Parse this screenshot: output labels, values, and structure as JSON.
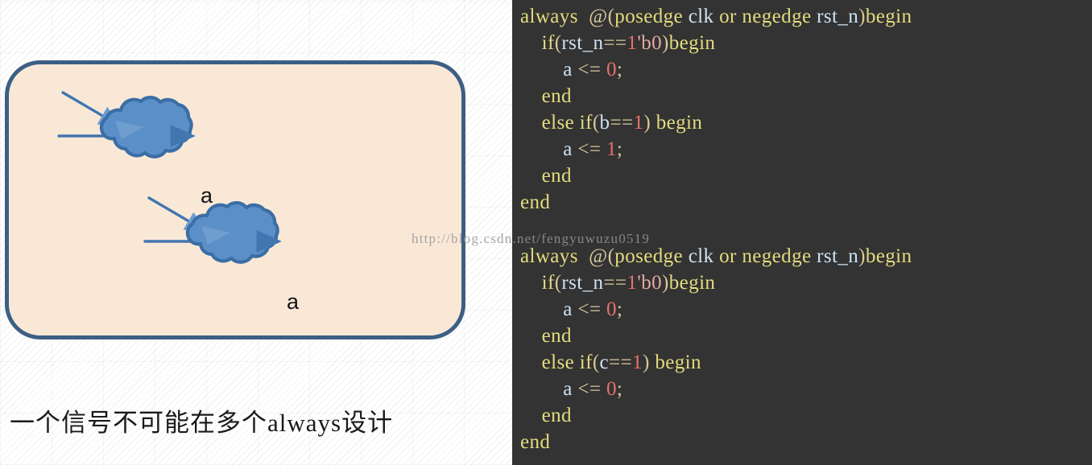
{
  "diagram": {
    "caption": "一个信号不可能在多个always设计",
    "panel_fill": "#fae8d7",
    "panel_border": "#3c5f84",
    "cloud_fill": "#5b8fc7",
    "cloud_stroke": "#3a6ea5",
    "arrow_color": "#4176b0",
    "blocks": [
      {
        "output_label": "a"
      },
      {
        "output_label": "a"
      }
    ]
  },
  "watermark": {
    "text": "http://blog.csdn.net/fengyuwuzu0519"
  },
  "code": {
    "background": "#333333",
    "keyword_color": "#e4dc7e",
    "identifier_color": "#cfe3f2",
    "operator_color": "#d8c89a",
    "number_color": "#e8716a",
    "blocks": [
      {
        "lines": [
          [
            {
              "t": "always",
              "c": "kw"
            },
            {
              "t": "  ",
              "c": "op"
            },
            {
              "t": "@(",
              "c": "op"
            },
            {
              "t": "posedge",
              "c": "kw"
            },
            {
              "t": " ",
              "c": "op"
            },
            {
              "t": "clk",
              "c": "id"
            },
            {
              "t": " ",
              "c": "op"
            },
            {
              "t": "or",
              "c": "kw"
            },
            {
              "t": " ",
              "c": "op"
            },
            {
              "t": "negedge",
              "c": "kw"
            },
            {
              "t": " ",
              "c": "op"
            },
            {
              "t": "rst_n",
              "c": "id"
            },
            {
              "t": ")",
              "c": "op"
            },
            {
              "t": "begin",
              "c": "kw"
            }
          ],
          [
            {
              "t": "    ",
              "c": "op"
            },
            {
              "t": "if",
              "c": "kw"
            },
            {
              "t": "(",
              "c": "op"
            },
            {
              "t": "rst_n",
              "c": "id"
            },
            {
              "t": "==",
              "c": "op"
            },
            {
              "t": "1",
              "c": "num"
            },
            {
              "t": "'b0",
              "c": "numb"
            },
            {
              "t": ")",
              "c": "op"
            },
            {
              "t": "begin",
              "c": "kw"
            }
          ],
          [
            {
              "t": "        ",
              "c": "op"
            },
            {
              "t": "a",
              "c": "id"
            },
            {
              "t": " <= ",
              "c": "op"
            },
            {
              "t": "0",
              "c": "num"
            },
            {
              "t": ";",
              "c": "op"
            }
          ],
          [
            {
              "t": "    ",
              "c": "op"
            },
            {
              "t": "end",
              "c": "kw"
            }
          ],
          [
            {
              "t": "    ",
              "c": "op"
            },
            {
              "t": "else",
              "c": "kw"
            },
            {
              "t": " ",
              "c": "op"
            },
            {
              "t": "if",
              "c": "kw"
            },
            {
              "t": "(",
              "c": "op"
            },
            {
              "t": "b",
              "c": "id"
            },
            {
              "t": "==",
              "c": "op"
            },
            {
              "t": "1",
              "c": "num"
            },
            {
              "t": ") ",
              "c": "op"
            },
            {
              "t": "begin",
              "c": "kw"
            }
          ],
          [
            {
              "t": "        ",
              "c": "op"
            },
            {
              "t": "a",
              "c": "id"
            },
            {
              "t": " <= ",
              "c": "op"
            },
            {
              "t": "1",
              "c": "num"
            },
            {
              "t": ";",
              "c": "op"
            }
          ],
          [
            {
              "t": "    ",
              "c": "op"
            },
            {
              "t": "end",
              "c": "kw"
            }
          ],
          [
            {
              "t": "end",
              "c": "kw"
            }
          ]
        ]
      },
      {
        "lines": [
          [
            {
              "t": "always",
              "c": "kw"
            },
            {
              "t": "  ",
              "c": "op"
            },
            {
              "t": "@(",
              "c": "op"
            },
            {
              "t": "posedge",
              "c": "kw"
            },
            {
              "t": " ",
              "c": "op"
            },
            {
              "t": "clk",
              "c": "id"
            },
            {
              "t": " ",
              "c": "op"
            },
            {
              "t": "or",
              "c": "kw"
            },
            {
              "t": " ",
              "c": "op"
            },
            {
              "t": "negedge",
              "c": "kw"
            },
            {
              "t": " ",
              "c": "op"
            },
            {
              "t": "rst_n",
              "c": "id"
            },
            {
              "t": ")",
              "c": "op"
            },
            {
              "t": "begin",
              "c": "kw"
            }
          ],
          [
            {
              "t": "    ",
              "c": "op"
            },
            {
              "t": "if",
              "c": "kw"
            },
            {
              "t": "(",
              "c": "op"
            },
            {
              "t": "rst_n",
              "c": "id"
            },
            {
              "t": "==",
              "c": "op"
            },
            {
              "t": "1",
              "c": "num"
            },
            {
              "t": "'b0",
              "c": "numb"
            },
            {
              "t": ")",
              "c": "op"
            },
            {
              "t": "begin",
              "c": "kw"
            }
          ],
          [
            {
              "t": "        ",
              "c": "op"
            },
            {
              "t": "a",
              "c": "id"
            },
            {
              "t": " <= ",
              "c": "op"
            },
            {
              "t": "0",
              "c": "num"
            },
            {
              "t": ";",
              "c": "op"
            }
          ],
          [
            {
              "t": "    ",
              "c": "op"
            },
            {
              "t": "end",
              "c": "kw"
            }
          ],
          [
            {
              "t": "    ",
              "c": "op"
            },
            {
              "t": "else",
              "c": "kw"
            },
            {
              "t": " ",
              "c": "op"
            },
            {
              "t": "if",
              "c": "kw"
            },
            {
              "t": "(",
              "c": "op"
            },
            {
              "t": "c",
              "c": "id"
            },
            {
              "t": "==",
              "c": "op"
            },
            {
              "t": "1",
              "c": "num"
            },
            {
              "t": ") ",
              "c": "op"
            },
            {
              "t": "begin",
              "c": "kw"
            }
          ],
          [
            {
              "t": "        ",
              "c": "op"
            },
            {
              "t": "a",
              "c": "id"
            },
            {
              "t": " <= ",
              "c": "op"
            },
            {
              "t": "0",
              "c": "num"
            },
            {
              "t": ";",
              "c": "op"
            }
          ],
          [
            {
              "t": "    ",
              "c": "op"
            },
            {
              "t": "end",
              "c": "kw"
            }
          ],
          [
            {
              "t": "end",
              "c": "kw"
            }
          ]
        ]
      }
    ]
  }
}
